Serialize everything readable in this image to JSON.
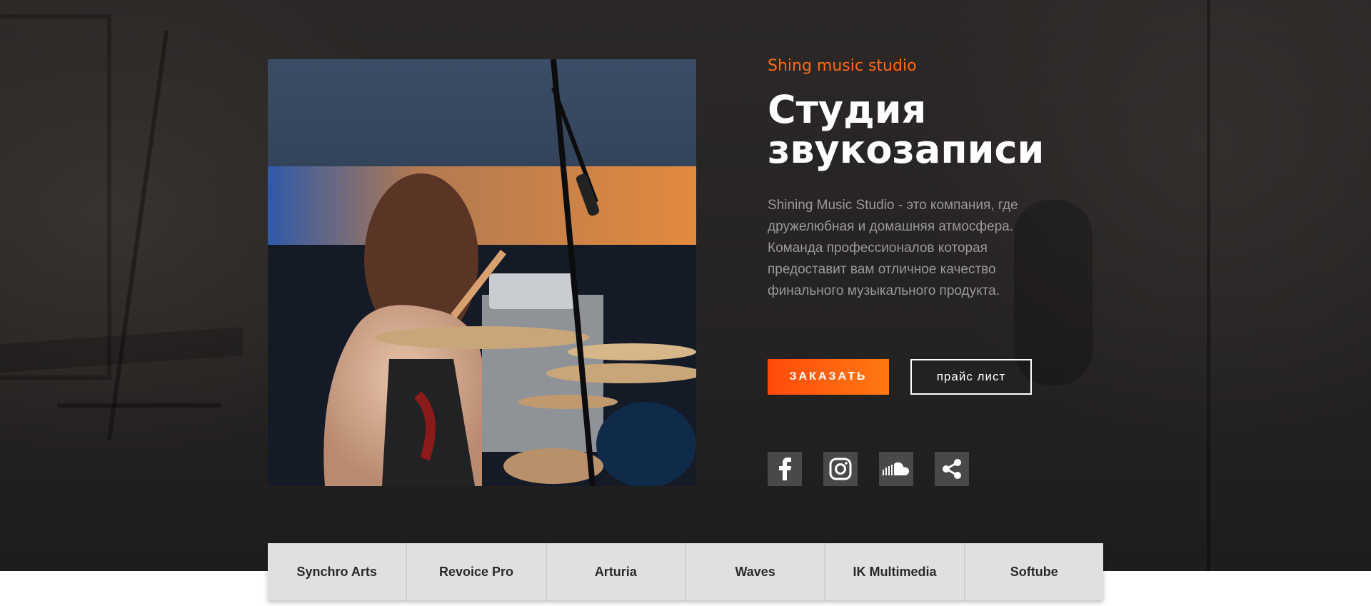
{
  "hero": {
    "eyebrow": "Shing music studio",
    "title_line1": "Студия",
    "title_line2": "звукозаписи",
    "description": "Shining Music Studio - это компания, где дружелюбная и домашняя атмосфера. Команда профессионалов которая предоставит вам отличное качество финального музыкального продукта.",
    "order_button": "ЗАКАЗАТЬ",
    "price_button": "прайс лист",
    "accent_color": "#ff6a10"
  },
  "social": [
    {
      "name": "facebook-icon"
    },
    {
      "name": "instagram-icon"
    },
    {
      "name": "soundcloud-icon"
    },
    {
      "name": "share-icon"
    }
  ],
  "brands": [
    "Synchro Arts",
    "Revoice Pro",
    "Arturia",
    "Waves",
    "IK Multimedia",
    "Softube"
  ]
}
